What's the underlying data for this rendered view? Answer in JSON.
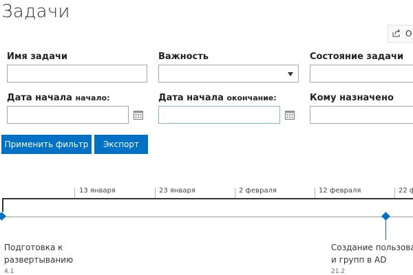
{
  "page": {
    "title": "Задачи"
  },
  "toolbar": {
    "share_label": "О",
    "share_icon": "share-icon"
  },
  "filters": {
    "task_name": {
      "label": "Имя задачи",
      "value": ""
    },
    "importance": {
      "label": "Важность",
      "selected": ""
    },
    "task_state": {
      "label": "Состояние задачи",
      "value": ""
    },
    "start_date_from": {
      "label": "Дата начала",
      "suffix": "начало:",
      "value": ""
    },
    "start_date_to": {
      "label": "Дата начала",
      "suffix": "окончание:",
      "value": ""
    },
    "assigned_to": {
      "label": "Кому назначено",
      "value": ""
    }
  },
  "buttons": {
    "apply_filter": "Применить фильтр",
    "export": "Экспорт"
  },
  "timeline": {
    "ticks": [
      "13 января",
      "23 января",
      "2 февраля",
      "12 февраля",
      "22 ф"
    ],
    "tasks": [
      {
        "name_line1": "Подготовка к",
        "name_line2": "развертыванию",
        "id": "4.1"
      },
      {
        "name_line1": "Создание пользова",
        "name_line2": "и групп в AD",
        "id": "21.2"
      }
    ],
    "accent_color": "#0072c6"
  }
}
